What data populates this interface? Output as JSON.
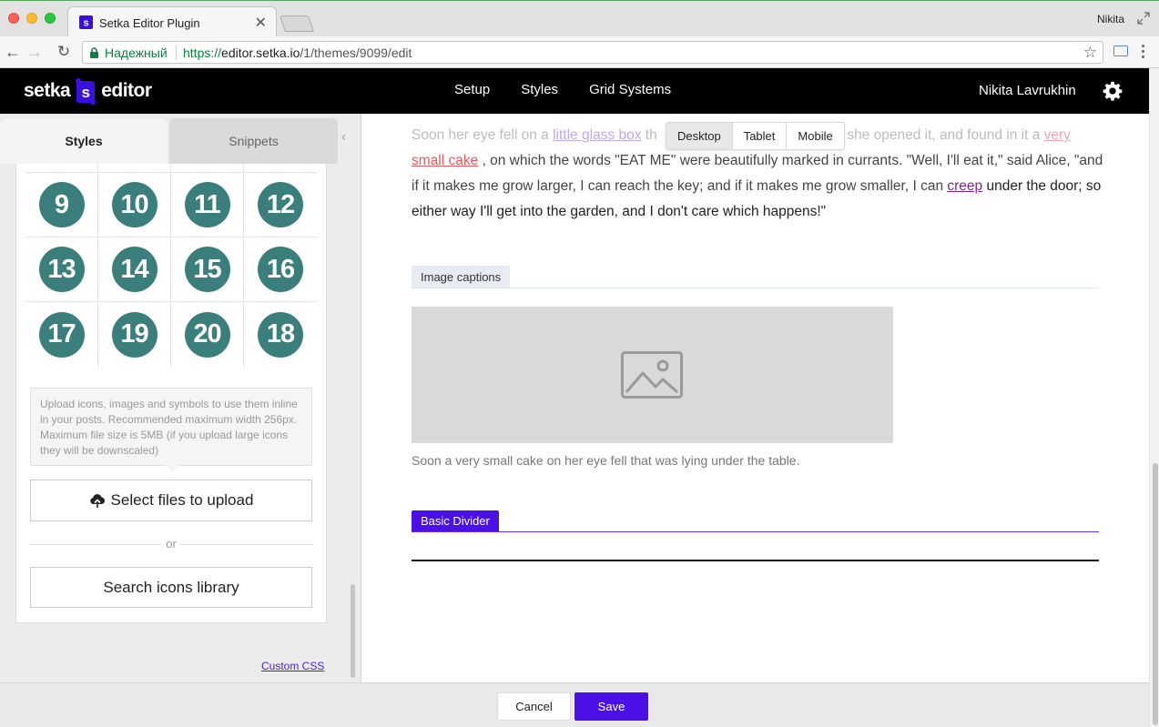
{
  "browser": {
    "tab_title": "Setka Editor Plugin",
    "profile_name": "Nikita",
    "secure_label": "Надежный",
    "url_scheme": "https://",
    "url_host": "editor.setka.io",
    "url_path": "/1/themes/9099/edit"
  },
  "header": {
    "logo_left": "setka",
    "logo_mark": "s",
    "logo_right": "editor",
    "nav": [
      "Setup",
      "Styles",
      "Grid Systems"
    ],
    "user_name": "Nikita Lavrukhin"
  },
  "sidebar": {
    "tabs": [
      "Styles",
      "Snippets"
    ],
    "icons": [
      [
        "9",
        "10",
        "11",
        "12"
      ],
      [
        "13",
        "14",
        "15",
        "16"
      ],
      [
        "17",
        "19",
        "20",
        "18"
      ]
    ],
    "upload_hint": "Upload icons, images and symbols to use them inline in your posts. Recommended maximum width 256px. Maximum file size is 5MB (if you upload large icons they will be downscaled)",
    "upload_button": "Select files to upload",
    "or_label": "or",
    "search_button": "Search icons library",
    "custom_css_link": "Custom CSS"
  },
  "content": {
    "device_options": [
      "Desktop",
      "Tablet",
      "Mobile"
    ],
    "active_device": "Desktop",
    "paragraph": {
      "p1": "Soon her eye fell on a ",
      "link1": " little glass box",
      "p2": " th",
      "p3": ": she opened it, and found in it a ",
      "link2a": "very",
      "link2b": "small cake",
      "p4": " , on which the words \"EAT ME\" were beautifully marked in currants. \"Well, I'll eat it,\" said Alice, \"and if it makes me grow larger, I can reach the key; and if it makes me grow smaller, I can ",
      "link3": "creep",
      "p5": " under the door; so either way I'll get into the garden, and I don't care which happens!\""
    },
    "image_captions_tag": "Image captions",
    "caption_text": "Soon a very small cake on her eye fell that was lying under the table.",
    "divider_tag": "Basic Divider",
    "colors": {
      "accent": "#4b10e6",
      "icon_bg": "#3b7f7c",
      "link_red": "#e15b60",
      "link_purple": "#7a2a95"
    }
  },
  "footer": {
    "cancel": "Cancel",
    "save": "Save"
  }
}
